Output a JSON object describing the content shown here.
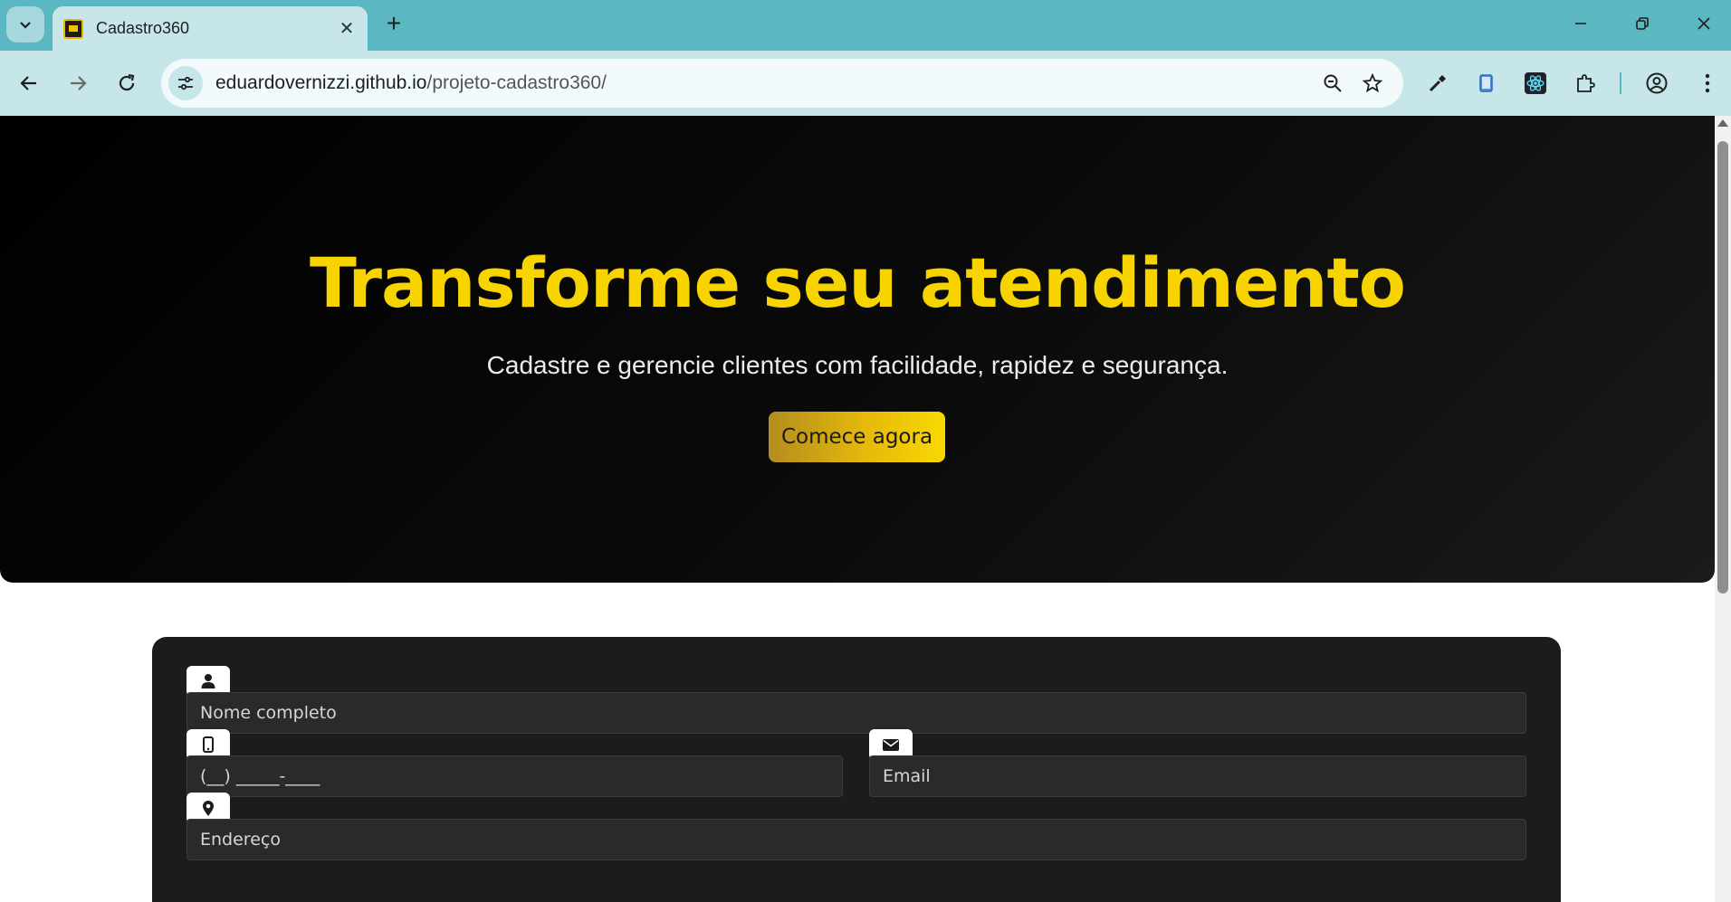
{
  "browser": {
    "tab_title": "Cadastro360",
    "url_host": "eduardovernizzi.github.io",
    "url_path": "/projeto-cadastro360/"
  },
  "hero": {
    "title": "Transforme seu atendimento",
    "subtitle": "Cadastre e gerencie clientes com facilidade, rapidez e segurança.",
    "cta_label": "Comece agora",
    "title_color": "#f7d300"
  },
  "form": {
    "name_placeholder": "Nome completo",
    "phone_value": "(__) _____-____",
    "email_placeholder": "Email",
    "address_placeholder": "Endereço",
    "icons": [
      "user-icon",
      "phone-icon",
      "envelope-icon",
      "map-pin-icon"
    ]
  }
}
